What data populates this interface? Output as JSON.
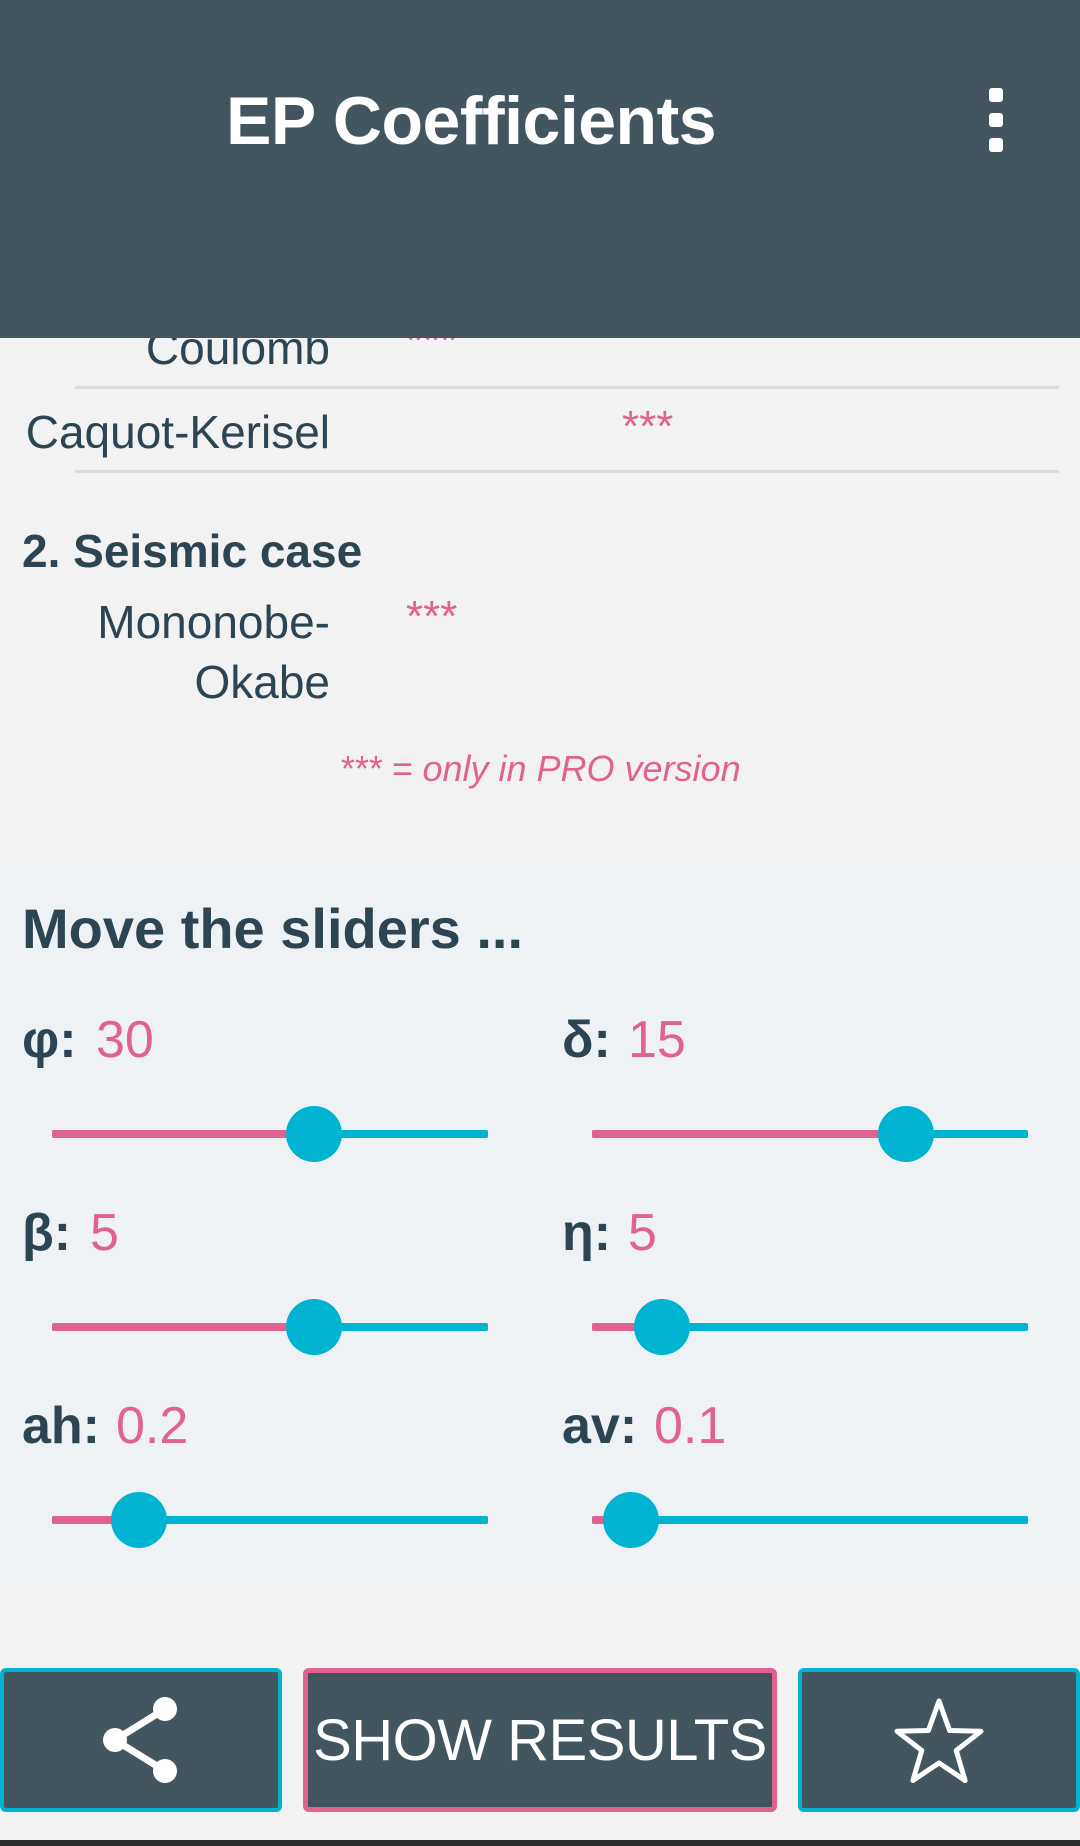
{
  "app_bar": {
    "title": "EP Coefficients",
    "overflow_icon": "more-vert-icon"
  },
  "static_methods": [
    {
      "name": "Coulomb",
      "value": "***"
    },
    {
      "name": "Caquot-Kerisel",
      "value": "***"
    }
  ],
  "seismic": {
    "heading": "2. Seismic case",
    "method_line1": "Mononobe-",
    "method_line2": "Okabe",
    "value": "***"
  },
  "pro_note": "*** = only in PRO version",
  "sliders": {
    "title": "Move the sliders ...",
    "items": [
      {
        "label": "φ:",
        "value": "30",
        "level": 0.6
      },
      {
        "label": "δ:",
        "value": "15",
        "level": 0.72
      },
      {
        "label": "β:",
        "value": "5",
        "level": 0.6
      },
      {
        "label": "η:",
        "value": "5",
        "level": 0.16
      },
      {
        "label": "ah:",
        "value": "0.2",
        "level": 0.2
      },
      {
        "label": "av:",
        "value": "0.1",
        "level": 0.09
      }
    ]
  },
  "bottom_bar": {
    "share_icon": "share-icon",
    "show_results_label": "SHOW RESULTS",
    "favorite_icon": "star-outline-icon"
  },
  "colors": {
    "header": "#43555f",
    "accent_pink": "#e0628f",
    "accent_cyan": "#00b3d1",
    "text_dark": "#2d4452"
  }
}
